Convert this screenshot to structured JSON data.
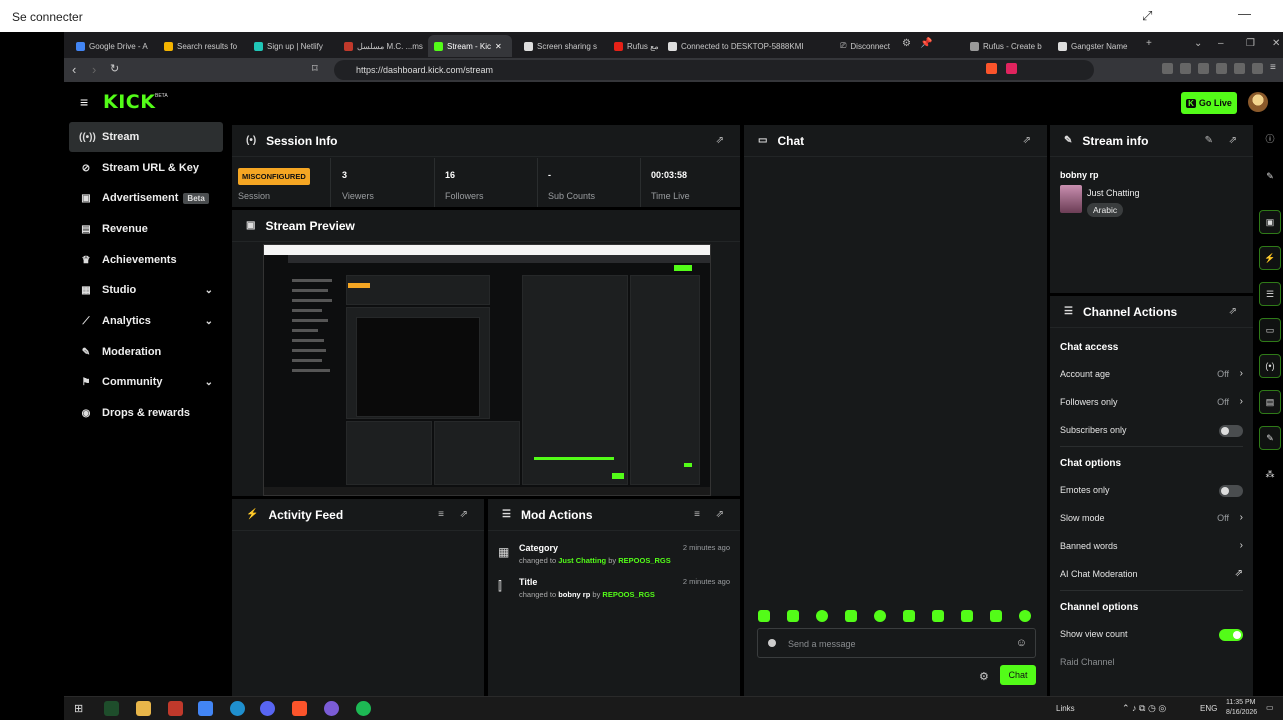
{
  "outer": {
    "title": "Se connecter"
  },
  "browser": {
    "tabs": [
      {
        "label": "Google Drive - A",
        "color": "#4285f4"
      },
      {
        "label": "Search results fo",
        "color": "#f4b400"
      },
      {
        "label": "Sign up | Netlify",
        "color": "#20c6b7"
      },
      {
        "label": "مسلسل M.C. ...ms",
        "color": "#c0392b"
      },
      {
        "label": "Stream - Kic",
        "color": "#53fc18"
      },
      {
        "label": "Screen sharing s",
        "color": "#dddddd"
      },
      {
        "label": "Rufus مع",
        "color": "#e62117"
      },
      {
        "label": "Connected to DESKTOP-5888KMI",
        "color": "#dddddd"
      }
    ],
    "tabs_right": [
      {
        "label": "Disconnect"
      },
      {
        "label": "Rufus - Create b"
      },
      {
        "label": "Gangster Name"
      }
    ],
    "url": "https://dashboard.kick.com/stream"
  },
  "app": {
    "logo": "KICK",
    "logo_sup": "BETA",
    "go_live": "Go Live"
  },
  "sidebar": {
    "items": [
      {
        "label": "Stream",
        "icon": "broadcast-icon"
      },
      {
        "label": "Stream URL & Key",
        "icon": "link-icon"
      },
      {
        "label": "Advertisement",
        "icon": "ad-icon",
        "badge": "Beta"
      },
      {
        "label": "Revenue",
        "icon": "chart-icon"
      },
      {
        "label": "Achievements",
        "icon": "trophy-icon"
      },
      {
        "label": "Studio",
        "icon": "studio-icon"
      },
      {
        "label": "Analytics",
        "icon": "analytics-icon"
      },
      {
        "label": "Moderation",
        "icon": "wrench-icon"
      },
      {
        "label": "Community",
        "icon": "community-icon"
      },
      {
        "label": "Drops & rewards",
        "icon": "drops-icon"
      }
    ]
  },
  "session": {
    "title": "Session Info",
    "status_badge": "MISCONFIGURED",
    "status_label": "Session",
    "viewers": "3",
    "viewers_label": "Viewers",
    "followers": "16",
    "followers_label": "Followers",
    "subs": "-",
    "subs_label": "Sub Counts",
    "time": "00:03:58",
    "time_label": "Time Live"
  },
  "preview": {
    "title": "Stream Preview"
  },
  "activity": {
    "title": "Activity Feed"
  },
  "mod_actions": {
    "title": "Mod Actions",
    "items": [
      {
        "title": "Category",
        "prefix": "changed to",
        "value": "Just Chatting",
        "by": "by",
        "user": "REPOOS_RGS",
        "time": "2 minutes ago"
      },
      {
        "title": "Title",
        "prefix": "changed to",
        "value": "bobny rp",
        "by": "by",
        "user": "REPOOS_RGS",
        "time": "2 minutes ago"
      }
    ]
  },
  "chat": {
    "title": "Chat",
    "placeholder": "Send a message",
    "send": "Chat"
  },
  "stream_info": {
    "title": "Stream info",
    "stream_title": "bobny rp",
    "category": "Just Chatting",
    "tag": "Arabic"
  },
  "channel_actions": {
    "title": "Channel Actions",
    "chat_access": "Chat access",
    "account_age": "Account age",
    "account_age_val": "Off",
    "followers_only": "Followers only",
    "followers_only_val": "Off",
    "subscribers_only": "Subscribers only",
    "chat_options": "Chat options",
    "emotes_only": "Emotes only",
    "slow_mode": "Slow mode",
    "slow_mode_val": "Off",
    "banned_words": "Banned words",
    "ai_mod": "AI Chat Moderation",
    "channel_options": "Channel options",
    "show_view_count": "Show view count",
    "raid_channel": "Raid Channel"
  },
  "taskbar": {
    "links": "Links",
    "lang": "ENG",
    "time": "11:35 PM",
    "date": "8/16/2026"
  },
  "colors": {
    "accent": "#53fc18",
    "warning": "#f5a623",
    "panel": "#17191a"
  }
}
